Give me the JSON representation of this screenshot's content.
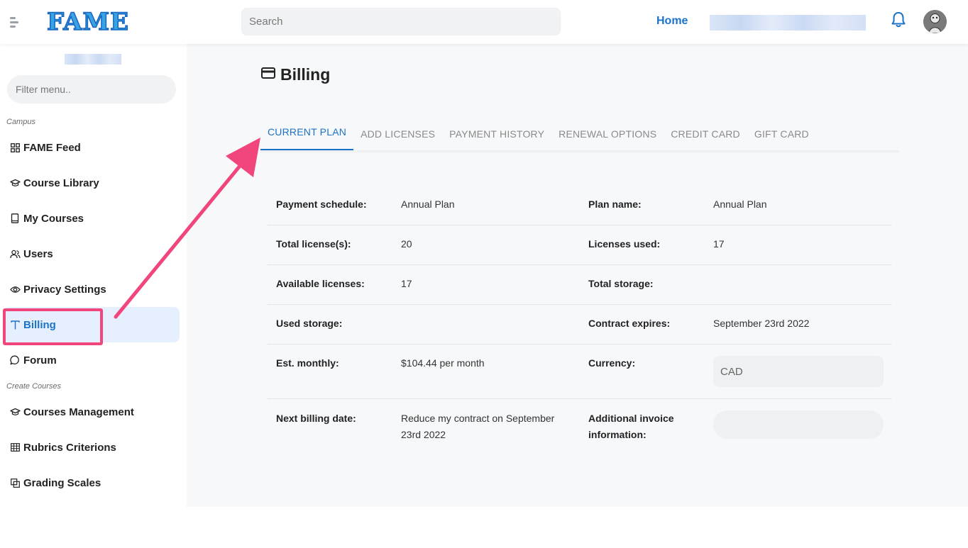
{
  "header": {
    "logo_text": "FAME",
    "search_placeholder": "Search",
    "home_link": "Home",
    "icons": {
      "menu": "menu-toggle-icon",
      "bell": "bell-icon",
      "avatar": "user-avatar"
    }
  },
  "sidebar": {
    "filter_placeholder": "Filter menu..",
    "sections": [
      {
        "label": "Campus"
      },
      {
        "label": "Create Courses"
      }
    ],
    "items": [
      {
        "label": "FAME Feed",
        "icon": "grid-icon"
      },
      {
        "label": "Course Library",
        "icon": "graduation-cap-icon"
      },
      {
        "label": "My Courses",
        "icon": "book-icon"
      },
      {
        "label": "Users",
        "icon": "users-icon"
      },
      {
        "label": "Privacy Settings",
        "icon": "eye-icon"
      },
      {
        "label": "Billing",
        "icon": "text-t-icon",
        "active": true
      },
      {
        "label": "Forum",
        "icon": "chat-bubble-icon"
      },
      {
        "label": "Courses Management",
        "icon": "graduation-cap-icon"
      },
      {
        "label": "Rubrics Criterions",
        "icon": "table-icon"
      },
      {
        "label": "Grading Scales",
        "icon": "scale-icon"
      }
    ]
  },
  "page": {
    "title": "Billing",
    "title_icon": "credit-card-icon",
    "tabs": [
      {
        "label": "CURRENT PLAN",
        "active": true
      },
      {
        "label": "ADD LICENSES"
      },
      {
        "label": "PAYMENT HISTORY"
      },
      {
        "label": "RENEWAL OPTIONS"
      },
      {
        "label": "CREDIT CARD"
      },
      {
        "label": "GIFT CARD"
      }
    ],
    "rows": [
      {
        "k1": "Payment schedule:",
        "v1": "Annual Plan",
        "k2": "Plan name:",
        "v2": "Annual Plan"
      },
      {
        "k1": "Total license(s):",
        "v1": "20",
        "k2": "Licenses used:",
        "v2": "17"
      },
      {
        "k1": "Available licenses:",
        "v1": "17",
        "k2": "Total storage:",
        "v2": ""
      },
      {
        "k1": "Used storage:",
        "v1": "",
        "k2": "Contract expires:",
        "v2": "September 23rd 2022"
      },
      {
        "k1": "Est. monthly:",
        "v1": "$104.44 per month",
        "k2": "Currency:",
        "v2": "CAD"
      },
      {
        "k1": "Next billing date:",
        "v1": "Reduce my contract on September 23rd 2022",
        "k2": "Additional invoice information:",
        "v2": ""
      }
    ]
  },
  "colors": {
    "accent": "#1a73c8",
    "active_bg": "#e6effd",
    "annotation": "#f0467c"
  }
}
